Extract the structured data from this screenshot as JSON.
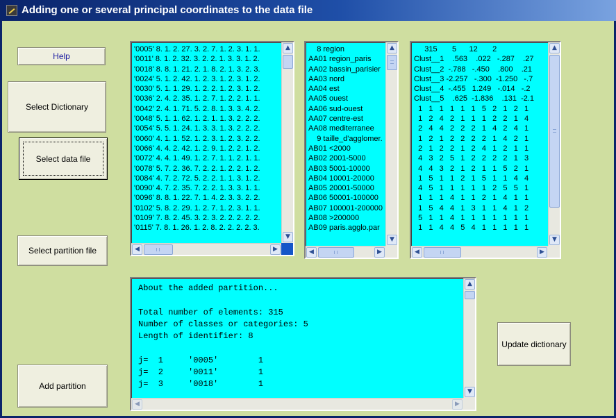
{
  "window": {
    "title": "Adding one or several principal coordinates to the data file"
  },
  "buttons": {
    "help": "Help",
    "select_dictionary": "Select Dictionary",
    "select_data_file": "Select data file",
    "select_partition_file": "Select partition file",
    "add_partition": "Add partition",
    "update_dictionary": "Update dictionary"
  },
  "data_list": {
    "lines": [
      "'0005' 8. 1. 2. 27. 3. 2. 7. 1. 2. 3. 1. 1.",
      "'0011' 8. 1. 2. 32. 3. 2. 2. 1. 3. 3. 1. 2.",
      "'0018' 8. 8. 1. 21. 2. 1. 8. 2. 1. 3. 2. 3.",
      "'0024' 5. 1. 2. 42. 1. 2. 3. 1. 2. 3. 1. 2.",
      "'0030' 5. 1. 1. 29. 1. 2. 2. 1. 2. 3. 1. 2.",
      "'0036' 2. 4. 2. 35. 1. 2. 7. 1. 2. 2. 1. 1.",
      "'0042' 2. 4. 1. 71. 5. 2. 8. 1. 3. 3. 4. 2.",
      "'0048' 5. 1. 1. 62. 1. 2. 1. 1. 3. 2. 2. 2.",
      "'0054' 5. 5. 1. 24. 1. 3. 3. 1. 3. 2. 2. 2.",
      "'0060' 4. 1. 1. 52. 1. 2. 3. 1. 2. 3. 2. 2.",
      "'0066' 4. 4. 2. 42. 1. 2. 9. 1. 2. 2. 1. 2.",
      "'0072' 4. 4. 1. 49. 1. 2. 7. 1. 1. 2. 1. 1.",
      "'0078' 5. 7. 2. 36. 7. 2. 2. 1. 2. 2. 1. 2.",
      "'0084' 4. 7. 2. 72. 5. 2. 2. 1. 1. 3. 1. 2.",
      "'0090' 4. 7. 2. 35. 7. 2. 2. 1. 3. 3. 1. 1.",
      "'0096' 8. 8. 1. 22. 7. 1. 4. 2. 3. 3. 2. 2.",
      "'0102' 5. 8. 2. 29. 1. 2. 7. 1. 2. 3. 1. 1.",
      "'0109' 7. 8. 2. 45. 3. 2. 3. 2. 2. 2. 2. 2.",
      "'0115' 7. 8. 1. 26. 1. 2. 8. 2. 2. 2. 2. 3."
    ]
  },
  "dictionary_list": {
    "lines": [
      "    8 region",
      "AA01 region_paris",
      "AA02 bassin_parisier",
      "AA03 nord",
      "AA04 est",
      "AA05 ouest",
      "AA06 sud-ouest",
      "AA07 centre-est",
      "AA08 mediterranee",
      "    9 taille_d'agglomer.",
      "AB01 <2000",
      "AB02 2001-5000",
      "AB03 5001-10000",
      "AB04 10001-20000",
      "AB05 20001-50000",
      "AB06 50001-100000",
      "AB07 100001-200000",
      "AB08 >200000",
      "AB09 paris.agglo.par"
    ]
  },
  "partition_list": {
    "lines": [
      "     315       5      12       2",
      "Clust__1    .563    .022   -.287    .27",
      "Clust__2  -.788   -.450    .800    .21",
      "Clust__3 -2.257   -.300  -1.250   -.7",
      "Clust__4  -.455   1.249   -.014   -.2",
      "Clust__5    .625  -1.836    .131  -2.1",
      "  1   1   1   1   1   1   5   2   1   2   1",
      "  1   2   4   2   1   1   1   2   2   1   4",
      "  2   4   4   2   2   2   1   4   2   4   1",
      "  1   2   1   2   2   2   2   1   4   2   1",
      "  2   1   2   2   1   2   4   1   2   1   1",
      "  4   3   2   5   1   2   2   2   2   1   3",
      "  4   4   3   2   1   2   1   1   5   2   1",
      "  1   5   1   1   2   1   5   1   1   4   4",
      "  4   5   1   1   1   1   1   2   5   5   1",
      "  1   1   1   4   1   1   2   1   4   1   1",
      "  1   5   4   4   1   3   1   1   4   1   2",
      "  5   1   1   4   1   1   1   1   1   1   1",
      "  1   1   4   4   5   4   1   1   1   1   1"
    ]
  },
  "info_memo": {
    "lines": [
      "About the added partition...",
      "",
      "Total number of elements: 315",
      "Number of classes or categories: 5",
      "Length of identifier: 8",
      "",
      "j=  1     '0005'        1",
      "j=  2     '0011'        1",
      "j=  3     '0018'        1"
    ]
  },
  "colors": {
    "list_background": "#00ffff",
    "window_background": "#cfdea0",
    "titlebar": "#0a246a"
  }
}
